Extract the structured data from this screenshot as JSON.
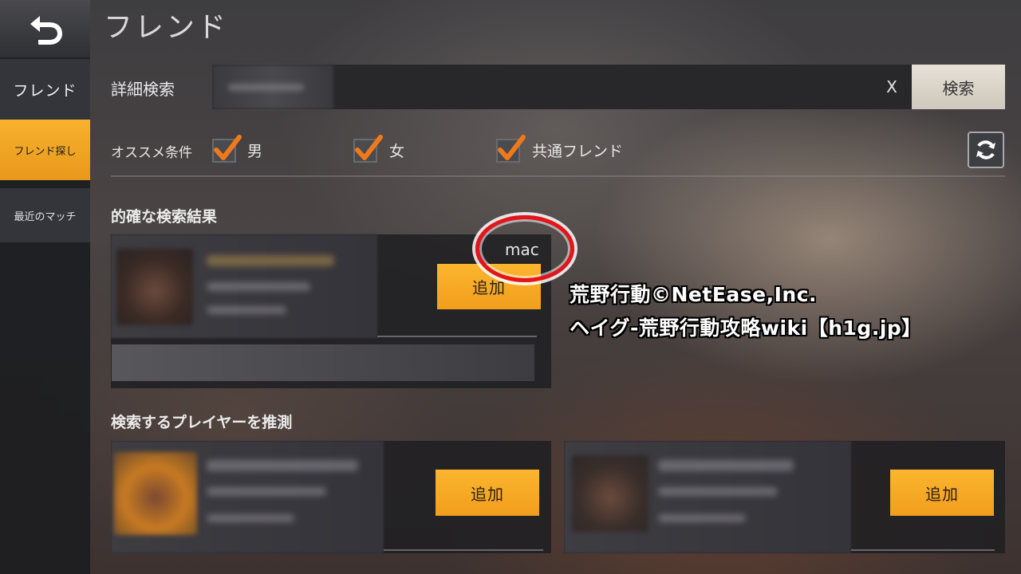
{
  "header": {
    "title": "フレンド",
    "back_icon": "back-arrow-icon"
  },
  "sidebar": {
    "items": [
      {
        "label": "フレンド",
        "active": false
      },
      {
        "label": "フレンド探し",
        "active": true
      },
      {
        "label": "最近のマッチ",
        "active": false
      }
    ]
  },
  "search": {
    "label": "詳細検索",
    "value": "",
    "clear_label": "X",
    "button_label": "検索"
  },
  "filters": {
    "label": "オススメ条件",
    "options": [
      {
        "label": "男",
        "checked": true
      },
      {
        "label": "女",
        "checked": true
      },
      {
        "label": "共通フレンド",
        "checked": true
      }
    ],
    "refresh_icon": "refresh-icon"
  },
  "exact_results": {
    "title": "的確な検索結果",
    "card": {
      "platform": "mac",
      "add_label": "追加"
    }
  },
  "suggested": {
    "title": "検索するプレイヤーを推測",
    "cards": [
      {
        "add_label": "追加"
      },
      {
        "add_label": "追加"
      }
    ]
  },
  "watermark": {
    "line1": "荒野行動©NetEase,Inc.",
    "line2": "ヘイグ-荒野行動攻略wiki【h1g.jp】"
  },
  "colors": {
    "accent": "#f6a623",
    "annotation": "#e5141b",
    "check": "#f07a1a"
  }
}
